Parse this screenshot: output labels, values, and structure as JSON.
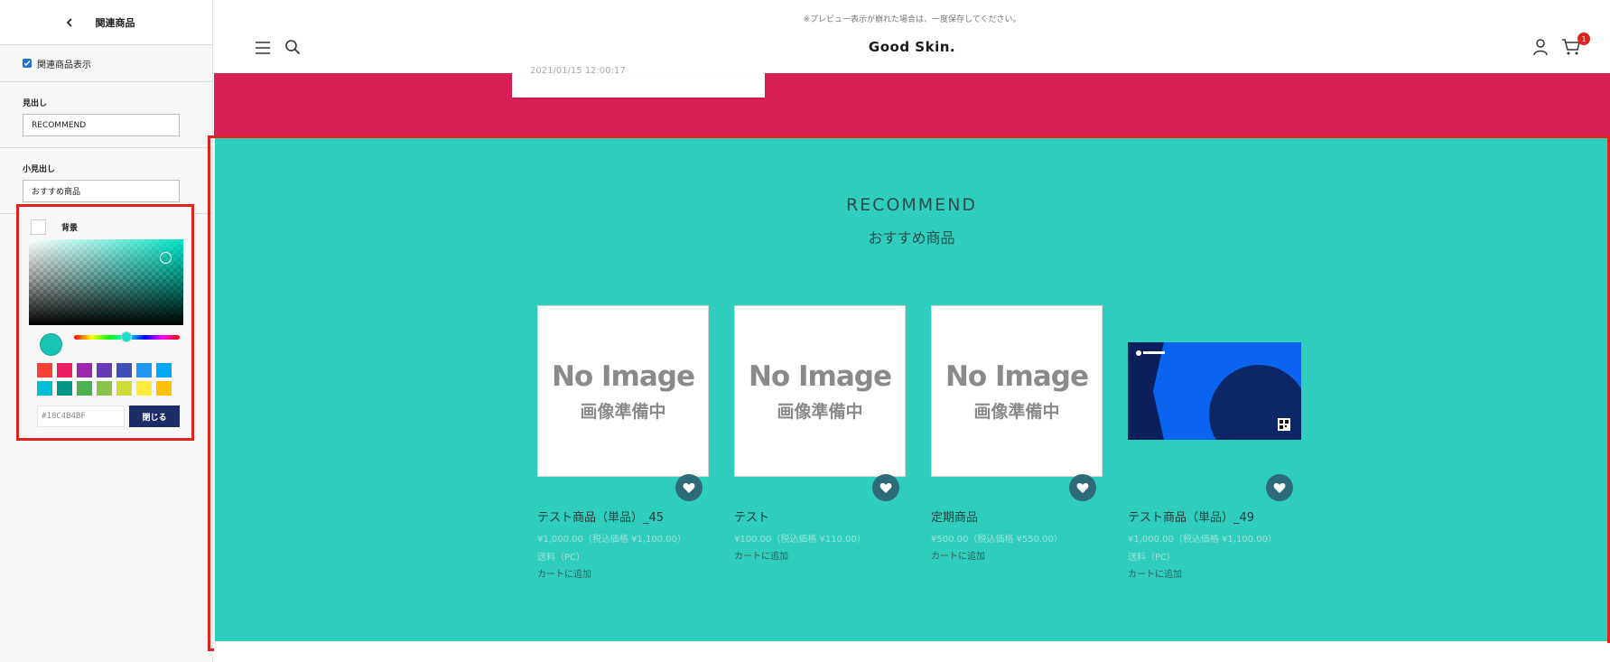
{
  "sidebar": {
    "title": "関連商品",
    "show_related_label": "関連商品表示",
    "heading_label": "見出し",
    "heading_value": "RECOMMEND",
    "subheading_label": "小見出し",
    "subheading_value": "おすすめ商品",
    "background_label": "背景",
    "color_picker": {
      "hex_value": "#18C4B4BF",
      "close_label": "閉じる",
      "swatches": [
        "#f44336",
        "#e91e63",
        "#9c27b0",
        "#673ab7",
        "#3f51b5",
        "#2196f3",
        "#03a9f4",
        "#00bcd4",
        "#009688",
        "#4caf50",
        "#8bc34a",
        "#cddc39",
        "#ffeb3b",
        "#ffc107"
      ]
    }
  },
  "preview": {
    "notice": "※プレビュー表示が崩れた場合は、一度保存してください。",
    "logo": "Good Skin.",
    "cart_count": "1",
    "card_fragment_text": "2021/01/15 12:00:17",
    "section_title": "RECOMMEND",
    "section_subtitle": "おすすめ商品",
    "no_image_en": "No Image",
    "no_image_jp": "画像準備中",
    "products": [
      {
        "name": "テスト商品（単品）_45",
        "price": "¥1,000.00（税込価格 ¥1,100.00）",
        "tax": "送料（PC）",
        "add": "カートに追加"
      },
      {
        "name": "テスト",
        "price": "¥100.00（税込価格 ¥110.00）",
        "tax": "",
        "add": "カートに追加"
      },
      {
        "name": "定期商品",
        "price": "¥500.00（税込価格 ¥550.00）",
        "tax": "",
        "add": "カートに追加"
      },
      {
        "name": "テスト商品（単品）_49",
        "price": "¥1,000.00（税込価格 ¥1,100.00）",
        "tax": "送料（PC）",
        "add": "カートに追加"
      }
    ]
  },
  "colors": {
    "section_bg": "#2ecdbd",
    "band_bg": "#d81f55",
    "highlight": "#e0241d",
    "accent": "#1a2d66"
  }
}
